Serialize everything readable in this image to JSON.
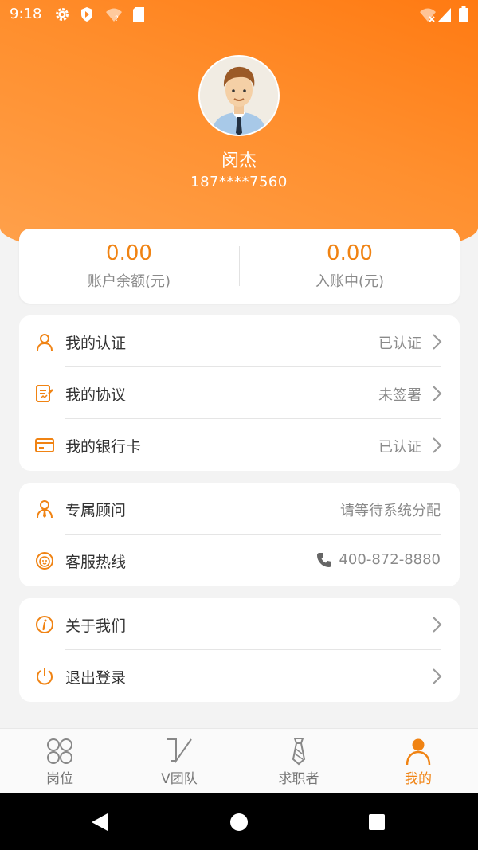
{
  "status_bar": {
    "time": "9:18"
  },
  "profile": {
    "name": "闵杰",
    "phone": "187****7560"
  },
  "balance": {
    "account": {
      "value": "0.00",
      "label": "账户余额(元)"
    },
    "pending": {
      "value": "0.00",
      "label": "入账中(元)"
    }
  },
  "group1": [
    {
      "label": "我的认证",
      "value": "已认证",
      "icon": "user-icon"
    },
    {
      "label": "我的协议",
      "value": "未签署",
      "icon": "document-edit-icon"
    },
    {
      "label": "我的银行卡",
      "value": "已认证",
      "icon": "bank-card-icon"
    }
  ],
  "group2": [
    {
      "label": "专属顾问",
      "value": "请等待系统分配",
      "icon": "advisor-icon"
    },
    {
      "label": "客服热线",
      "value": "400-872-8880",
      "icon": "customer-service-icon"
    }
  ],
  "group3": [
    {
      "label": "关于我们",
      "icon": "info-icon"
    },
    {
      "label": "退出登录",
      "icon": "power-icon"
    }
  ],
  "tabs": [
    {
      "label": "岗位",
      "icon": "grid-icon"
    },
    {
      "label": "V团队",
      "icon": "v-team-icon"
    },
    {
      "label": "求职者",
      "icon": "tie-icon"
    },
    {
      "label": "我的",
      "icon": "person-icon",
      "active": true
    }
  ],
  "colors": {
    "accent": "#f08313",
    "header_gradient_start": "#ff7a12",
    "header_gradient_end": "#ffa24d"
  }
}
